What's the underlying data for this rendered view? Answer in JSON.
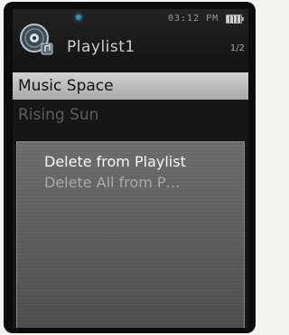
{
  "status": {
    "time": "03:12 PM",
    "page": "1/2"
  },
  "header": {
    "title": "Playlist1",
    "icon": "music-disc-icon"
  },
  "list": {
    "items": [
      {
        "label": "Music Space",
        "selected": true
      },
      {
        "label": "Rising Sun",
        "selected": false
      }
    ]
  },
  "menu": {
    "items": [
      {
        "label": "Delete from Playlist"
      },
      {
        "label": "Delete All from P…"
      }
    ]
  },
  "colors": {
    "background": "#161616",
    "selection": "#bfbfbf",
    "popup": "#5e5e5e",
    "accent": "#2f8fbf"
  }
}
